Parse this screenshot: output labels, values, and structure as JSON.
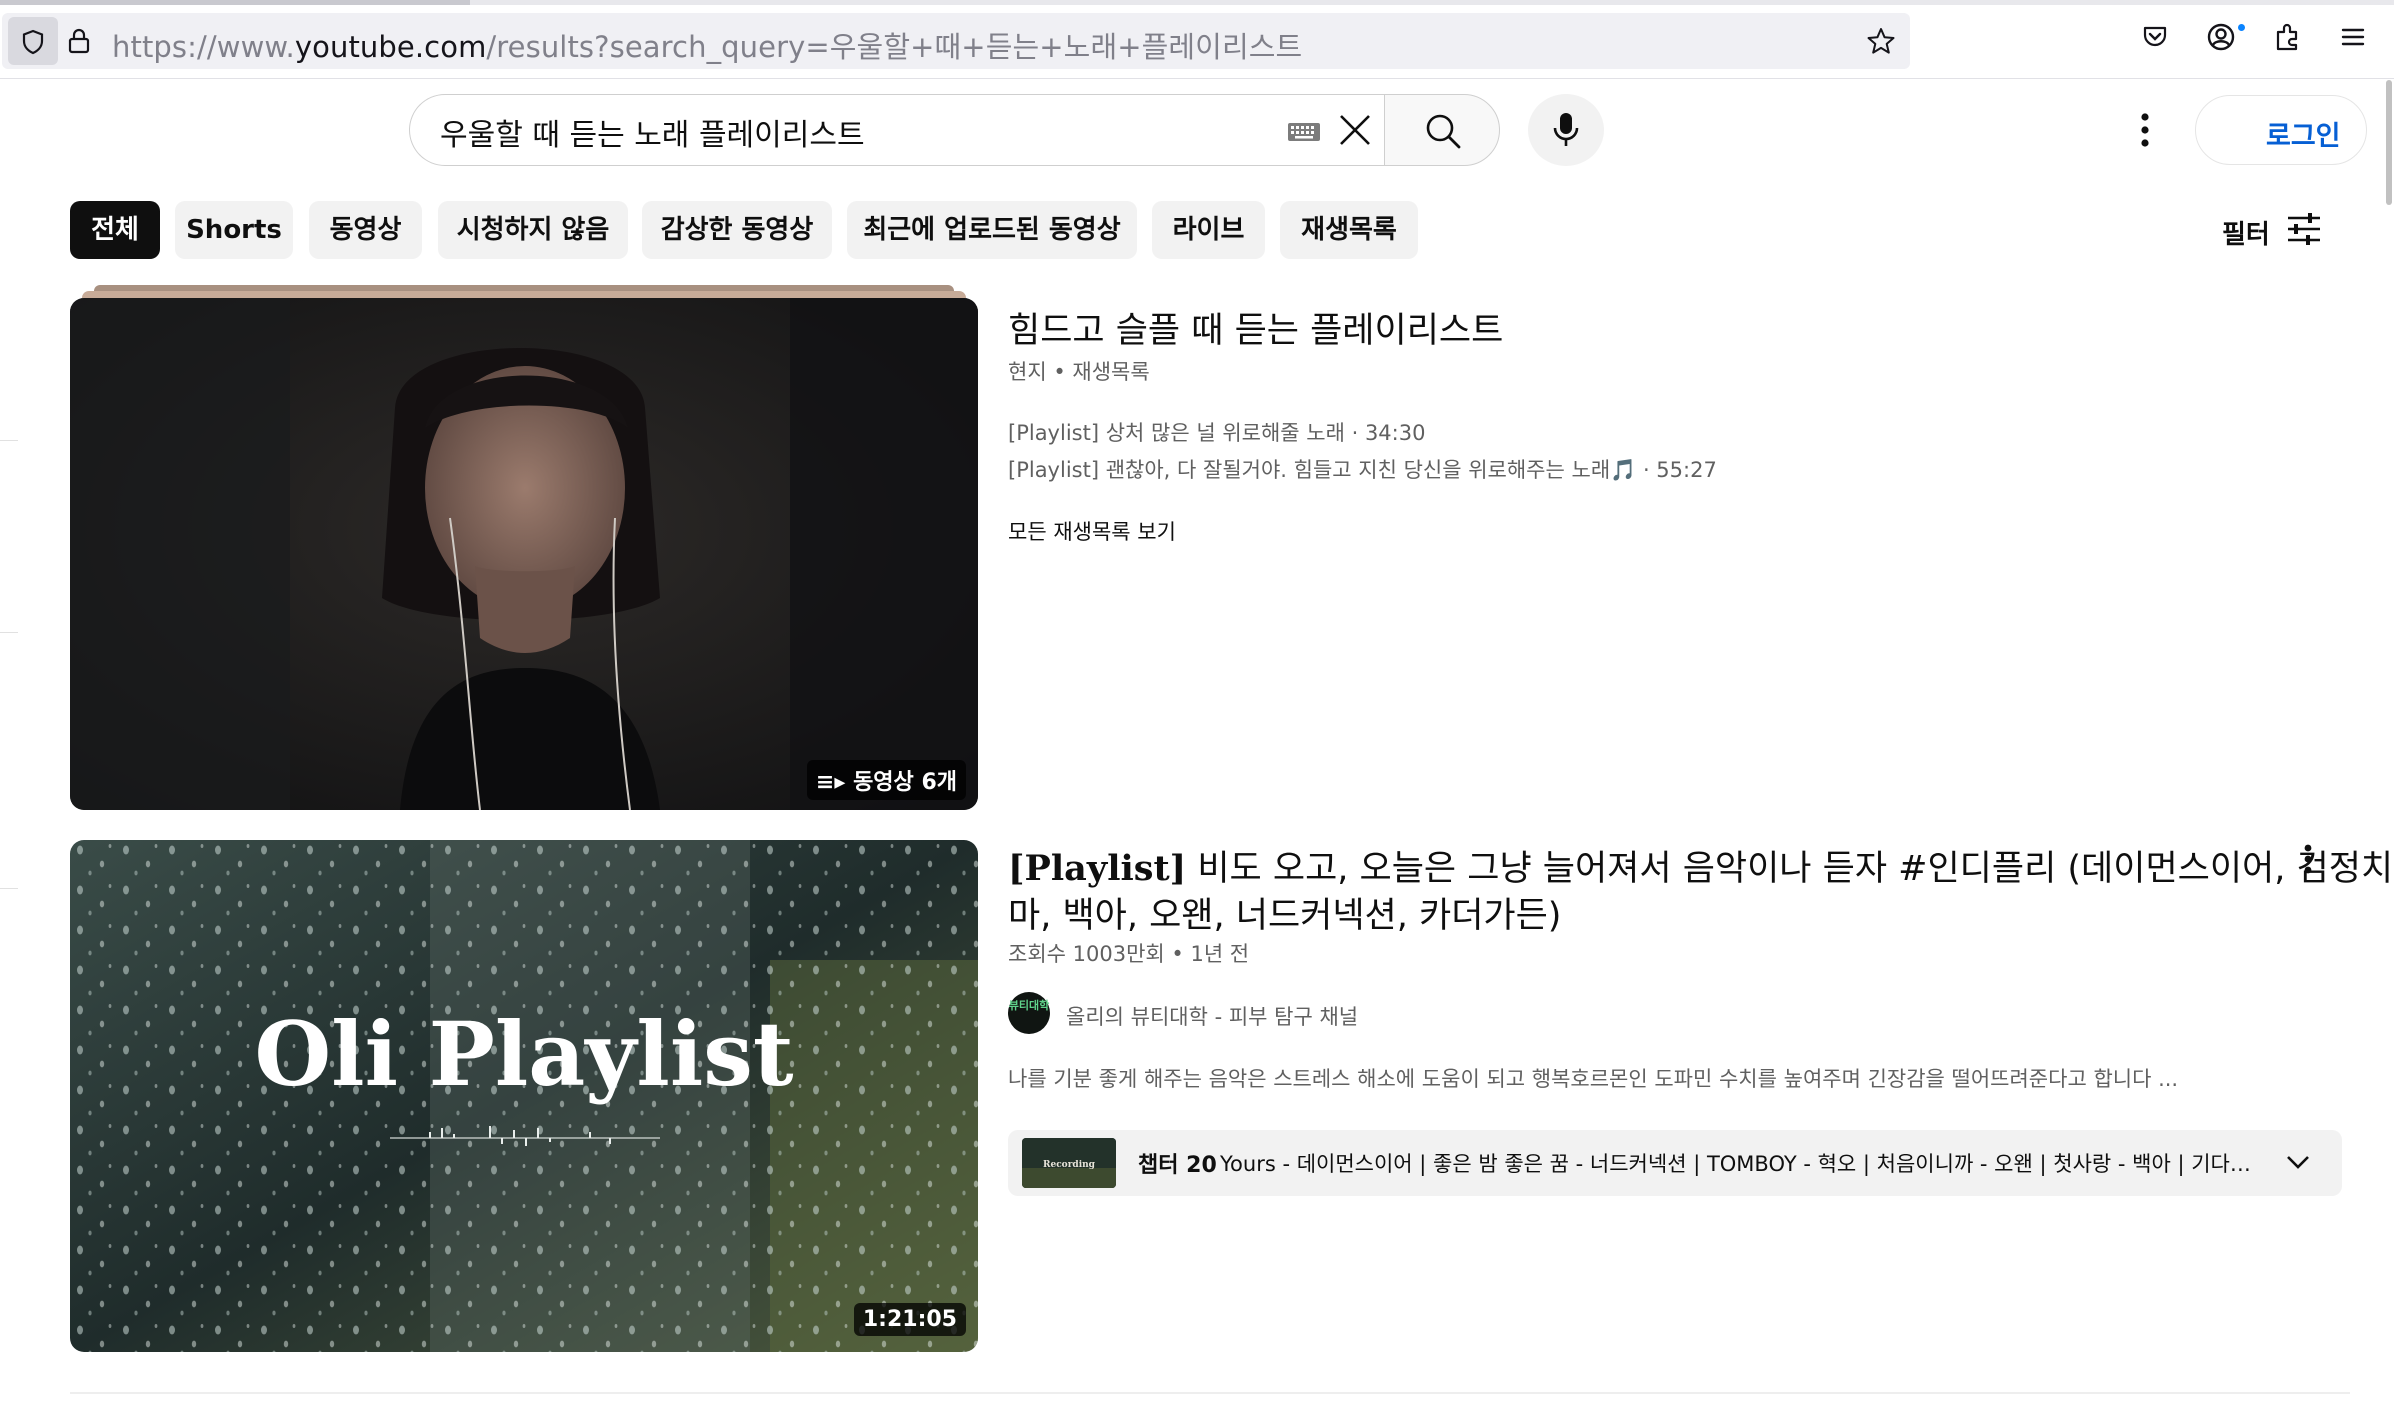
{
  "browser": {
    "url_prefix": "https://www.",
    "url_host": "youtube.com",
    "url_path": "/results?search_query=우울할+때+듣는+노래+플레이리스트"
  },
  "header": {
    "search_query": "우울할 때 듣는 노래 플레이리스트",
    "signin_label": "로그인"
  },
  "chips": [
    {
      "label": "전체",
      "active": true
    },
    {
      "label": "Shorts"
    },
    {
      "label": "동영상"
    },
    {
      "label": "시청하지 않음"
    },
    {
      "label": "감상한 동영상"
    },
    {
      "label": "최근에 업로드된 동영상"
    },
    {
      "label": "라이브"
    },
    {
      "label": "재생목록"
    }
  ],
  "filter_label": "필터",
  "results": [
    {
      "type": "playlist",
      "title": "힘드고 슬플 때 듣는 플레이리스트",
      "meta": "현지 • 재생목록",
      "items": [
        "[Playlist] 상처 많은 널 위로해줄 노래 · 34:30",
        "[Playlist] 괜찮아, 다 잘될거야. 힘들고 지친 당신을 위로해주는 노래🎵 · 55:27"
      ],
      "view_all": "모든 재생목록 보기",
      "badge": "동영상 6개"
    },
    {
      "type": "video",
      "title_bold": "[Playlist]",
      "title_line1": " 비도 오고, 오늘은 그냥 늘어져서 음악이나 듣자 #인디플리 (데이먼스이어, 검정치",
      "title_line2": "마, 백아, 오왠, 너드커넥션, 카더가든)",
      "meta": "조회수 1003만회 • 1년 전",
      "channel": "올리의 뷰티대학 - 피부 탐구 채널",
      "channel_avatar_text": "뷰티대학",
      "description": "나를 기분 좋게 해주는 음악은 스트레스 해소에 도움이 되고 행복호르몬인 도파민 수치를 높여주며 긴장감을 떨어뜨려준다고 합니다 ...",
      "thumb_text": "Oli Playlist",
      "duration": "1:21:05",
      "chapter_label": "챕터 20",
      "chapter_thumb_text": "Recording",
      "chapter_text": "Yours - 데이먼스이어 | 좋은 밤 좋은 꿈 - 너드커넥션 | TOMBOY - 혁오 | 처음이니까 - 오왠 | 첫사랑 - 백아 | 기다린 ..."
    }
  ]
}
